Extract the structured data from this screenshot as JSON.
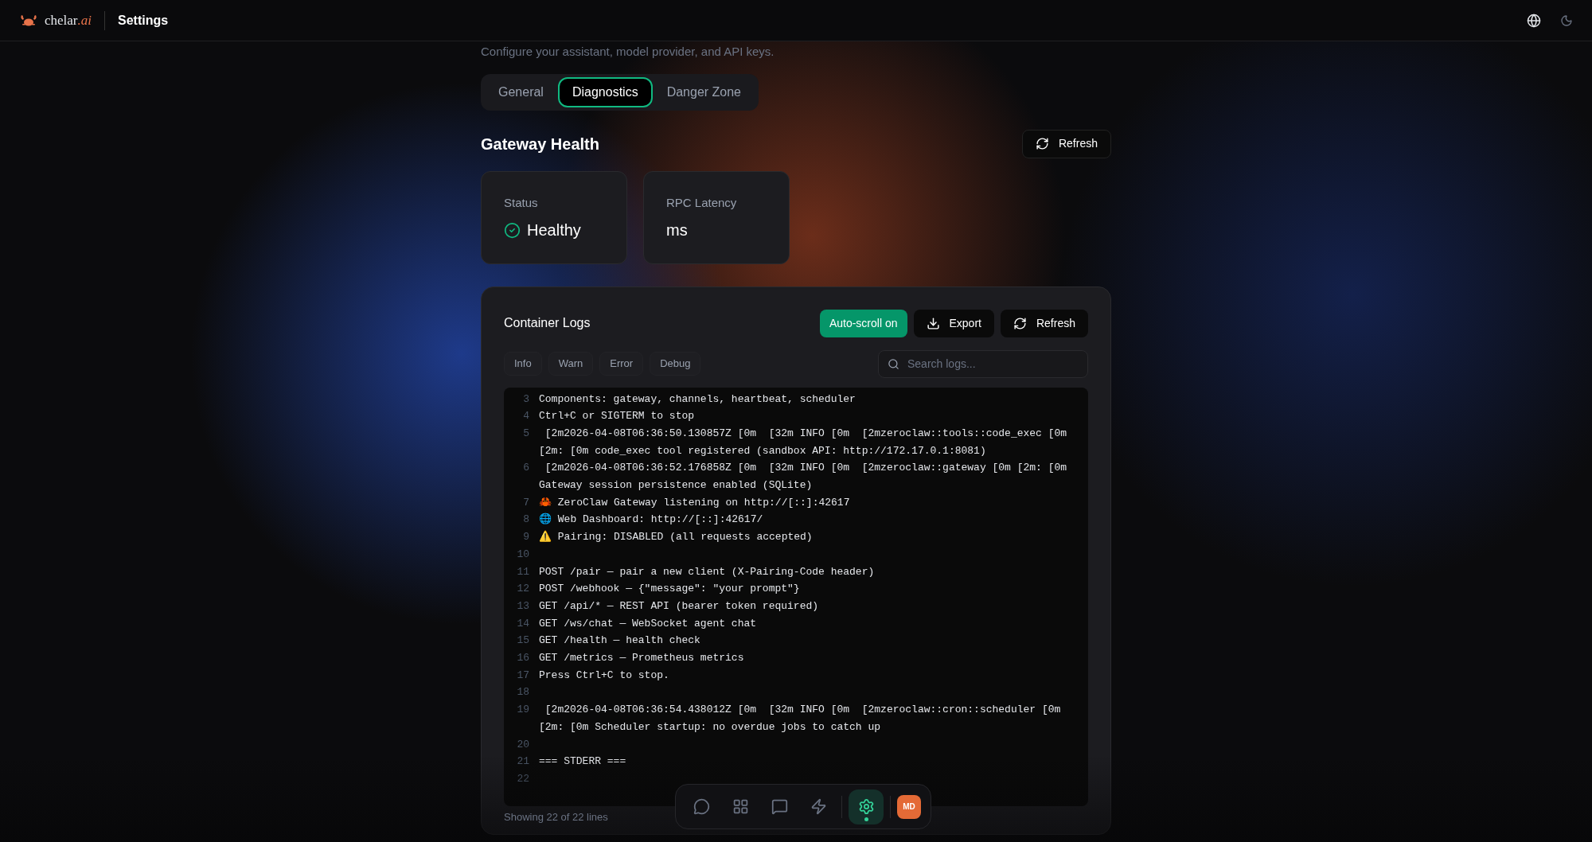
{
  "header": {
    "brand": {
      "name": "chelar",
      "suffix": ".ai"
    },
    "title": "Settings"
  },
  "subtitle": "Configure your assistant, model provider, and API keys.",
  "tabs": [
    {
      "label": "General",
      "selected": false
    },
    {
      "label": "Diagnostics",
      "selected": true
    },
    {
      "label": "Danger Zone",
      "selected": false
    }
  ],
  "health": {
    "title": "Gateway Health",
    "refresh": "Refresh",
    "cards": [
      {
        "kind": "status",
        "label": "Status",
        "value": "Healthy",
        "healthy": true
      },
      {
        "kind": "latency",
        "label": "RPC Latency",
        "value": "ms"
      }
    ]
  },
  "logs": {
    "title": "Container Logs",
    "autoscroll": {
      "label": "Auto-scroll on",
      "on": true
    },
    "export": "Export",
    "refresh": "Refresh",
    "filters": [
      {
        "label": "Info",
        "selected": false
      },
      {
        "label": "Warn",
        "selected": false
      },
      {
        "label": "Error",
        "selected": false
      },
      {
        "label": "Debug",
        "selected": false
      }
    ],
    "search": {
      "placeholder": "Search logs..."
    },
    "lines": [
      {
        "number": "3",
        "text": "Components: gateway, channels, heartbeat, scheduler"
      },
      {
        "number": "4",
        "text": "Ctrl+C or SIGTERM to stop"
      },
      {
        "number": "5",
        "text": " [2m2026-04-08T06:36:50.130857Z [0m  [32m INFO [0m  [2mzeroclaw::tools::code_exec [0m [2m: [0m code_exec tool registered (sandbox API: http://172.17.0.1:8081)"
      },
      {
        "number": "6",
        "text": " [2m2026-04-08T06:36:52.176858Z [0m  [32m INFO [0m  [2mzeroclaw::gateway [0m [2m: [0m Gateway session persistence enabled (SQLite)"
      },
      {
        "number": "7",
        "text": "🦀 ZeroClaw Gateway listening on http://[::]:42617"
      },
      {
        "number": "8",
        "text": "🌐 Web Dashboard: http://[::]:42617/"
      },
      {
        "number": "9",
        "text": "⚠️ Pairing: DISABLED (all requests accepted)"
      },
      {
        "number": "10"
      },
      {
        "number": "11",
        "text": "POST /pair — pair a new client (X-Pairing-Code header)"
      },
      {
        "number": "12",
        "text": "POST /webhook — {\"message\": \"your prompt\"}"
      },
      {
        "number": "13",
        "text": "GET /api/* — REST API (bearer token required)"
      },
      {
        "number": "14",
        "text": "GET /ws/chat — WebSocket agent chat"
      },
      {
        "number": "15",
        "text": "GET /health — health check"
      },
      {
        "number": "16",
        "text": "GET /metrics — Prometheus metrics"
      },
      {
        "number": "17",
        "text": "Press Ctrl+C to stop."
      },
      {
        "number": "18"
      },
      {
        "number": "19",
        "text": " [2m2026-04-08T06:36:54.438012Z [0m  [32m INFO [0m  [2mzeroclaw::cron::scheduler [0m [2m: [0m Scheduler startup: no overdue jobs to catch up"
      },
      {
        "number": "20"
      },
      {
        "number": "21",
        "text": "=== STDERR ==="
      },
      {
        "number": "22"
      }
    ],
    "footer": "Showing 22 of 22 lines"
  },
  "dock": {
    "items": [
      {
        "kind": "chat",
        "selected": false
      },
      {
        "kind": "apps",
        "selected": false
      },
      {
        "kind": "messages",
        "selected": false
      },
      {
        "kind": "automations",
        "selected": false
      },
      {
        "kind": "settings",
        "selected": true
      }
    ],
    "avatar": "MD"
  }
}
